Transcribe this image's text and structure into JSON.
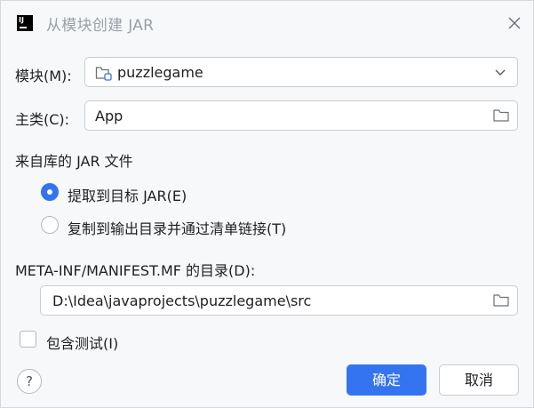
{
  "dialog": {
    "title": "从模块创建 JAR",
    "close_icon": "close-icon",
    "app_icon": "intellij-idea-logo"
  },
  "module": {
    "label": "模块(M):",
    "value": "puzzlegame",
    "icon": "module-folder-icon"
  },
  "main_class": {
    "label": "主类(C):",
    "value": "App",
    "browse_icon": "folder-icon"
  },
  "jar_section": {
    "label": "来自库的 JAR 文件",
    "options": [
      {
        "label": "提取到目标 JAR(E)",
        "selected": true
      },
      {
        "label": "复制到输出目录并通过清单链接(T)",
        "selected": false
      }
    ]
  },
  "manifest": {
    "label": "META-INF/MANIFEST.MF 的目录(D):",
    "value": "D:\\Idea\\javaprojects\\puzzlegame\\src",
    "browse_icon": "folder-icon"
  },
  "include_tests": {
    "label": "包含测试(I)",
    "checked": false
  },
  "footer": {
    "help_label": "?",
    "ok_label": "确定",
    "cancel_label": "取消"
  },
  "colors": {
    "accent": "#3574f0",
    "background": "#f7f8fa",
    "border": "#c9ccd1"
  }
}
